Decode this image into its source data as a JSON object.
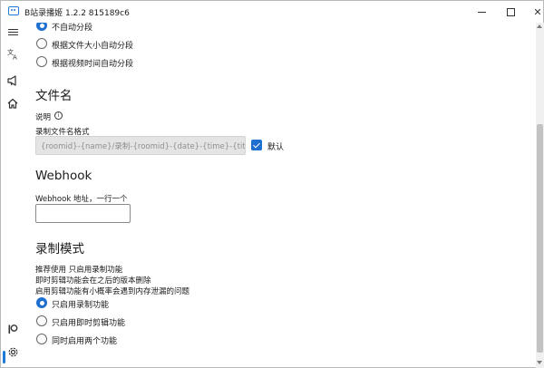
{
  "window": {
    "title": "B站录播姬 1.2.2 815189c6"
  },
  "sidebar": {
    "items": [
      {
        "icon": "hamburger-menu-icon"
      },
      {
        "icon": "translate-icon"
      },
      {
        "icon": "announcement-icon"
      },
      {
        "icon": "home-icon"
      },
      {
        "icon": "patreon-icon"
      },
      {
        "icon": "settings-gear-icon",
        "active": true
      }
    ]
  },
  "split_options": {
    "items": [
      {
        "label": "不自动分段",
        "checked": true
      },
      {
        "label": "根据文件大小自动分段",
        "checked": false
      },
      {
        "label": "根据视频时间自动分段",
        "checked": false
      }
    ]
  },
  "filename": {
    "title": "文件名",
    "description_label": "说明",
    "format_label": "录制文件名格式",
    "format_value": "{roomid}-{name}/录制-{roomid}-{date}-{time}-{title}.fl",
    "default_checked": true,
    "default_label": "默认"
  },
  "webhook": {
    "title": "Webhook",
    "field_label": "Webhook 地址，一行一个",
    "field_value": ""
  },
  "record_mode": {
    "title": "录制模式",
    "notes": [
      "推荐使用 只启用录制功能",
      "即时剪辑功能会在之后的版本删除",
      "启用剪辑功能有小概率会遇到内存泄漏的问题"
    ],
    "options": [
      {
        "label": "只启用录制功能",
        "checked": true
      },
      {
        "label": "只启用即时剪辑功能",
        "checked": false
      },
      {
        "label": "同时启用两个功能",
        "checked": false
      }
    ]
  },
  "colors": {
    "accent": "#1e6fd0",
    "disabled_field": "#e4e4e4"
  }
}
